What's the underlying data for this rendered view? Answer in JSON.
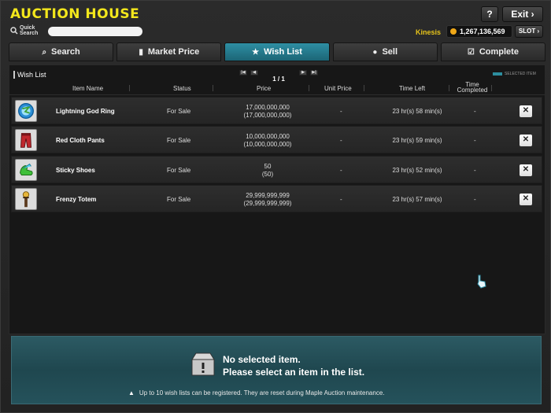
{
  "header": {
    "title": "AUCTION HOUSE",
    "quick_search_label": "Quick Search",
    "quick_search_value": "",
    "help_label": "?",
    "exit_label": "Exit",
    "world_name": "Kinesis",
    "meso_amount": "1,267,136,569",
    "slot_label": "SLOT"
  },
  "tabs": [
    {
      "label": "Search",
      "icon": "search-icon",
      "active": false
    },
    {
      "label": "Market Price",
      "icon": "bar-chart-icon",
      "active": false
    },
    {
      "label": "Wish List",
      "icon": "star-icon",
      "active": true
    },
    {
      "label": "Sell",
      "icon": "coin-icon",
      "active": false
    },
    {
      "label": "Complete",
      "icon": "checkbox-icon",
      "active": false
    }
  ],
  "panel": {
    "title": "Wish List",
    "page": "1 / 1",
    "legend_label": "SELECTED ITEM"
  },
  "columns": {
    "name": "Item Name",
    "status": "Status",
    "price": "Price",
    "unit_price": "Unit Price",
    "time_left": "Time Left",
    "time_completed": "Time Completed"
  },
  "rows": [
    {
      "name": "Lightning God Ring",
      "status": "For Sale",
      "price": "17,000,000,000",
      "price_sub": "(17,000,000,000)",
      "unit": "-",
      "time_left": "23 hr(s) 58 min(s)",
      "completed": "-",
      "icon": "ring-icon"
    },
    {
      "name": "Red Cloth Pants",
      "status": "For Sale",
      "price": "10,000,000,000",
      "price_sub": "(10,000,000,000)",
      "unit": "-",
      "time_left": "23 hr(s) 59 min(s)",
      "completed": "-",
      "icon": "pants-icon"
    },
    {
      "name": "Sticky Shoes",
      "status": "For Sale",
      "price": "50",
      "price_sub": "(50)",
      "unit": "-",
      "time_left": "23 hr(s) 52 min(s)",
      "completed": "-",
      "icon": "shoes-icon"
    },
    {
      "name": "Frenzy Totem",
      "status": "For Sale",
      "price": "29,999,999,999",
      "price_sub": "(29,999,999,999)",
      "unit": "-",
      "time_left": "23 hr(s) 57 min(s)",
      "completed": "-",
      "icon": "totem-icon"
    }
  ],
  "detail": {
    "line1": "No selected item.",
    "line2": "Please select an item in the list.",
    "notice": "Up to 10 wish lists can be registered. They are reset during Maple Auction maintenance."
  }
}
